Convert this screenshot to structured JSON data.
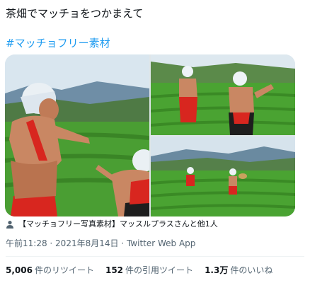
{
  "tweet": {
    "text_line1": "茶畑でマッチョをつかまえて",
    "hashtag": "#マッチョフリー素材"
  },
  "media": {
    "count": 3,
    "colors": {
      "tea": "#3f9a2f",
      "sky": "#d7e6f0",
      "mountain": "#5d7f9a",
      "skin": "#c98763",
      "apron_red": "#d8261f",
      "bandana": "#eef3f7"
    }
  },
  "tagged": {
    "icon": "person-icon",
    "text": "【マッチョフリー写真素材】マッスルプラスさんと他1人"
  },
  "meta": {
    "time": "午前11:28",
    "separator1": " · ",
    "date": "2021年8月14日",
    "separator2": " · ",
    "client": "Twitter Web App"
  },
  "stats": {
    "retweets": {
      "count": "5,006",
      "label": "件のリツイート"
    },
    "quotes": {
      "count": "152",
      "label": "件の引用ツイート"
    },
    "likes": {
      "count": "1.3万",
      "label": "件のいいね"
    }
  }
}
